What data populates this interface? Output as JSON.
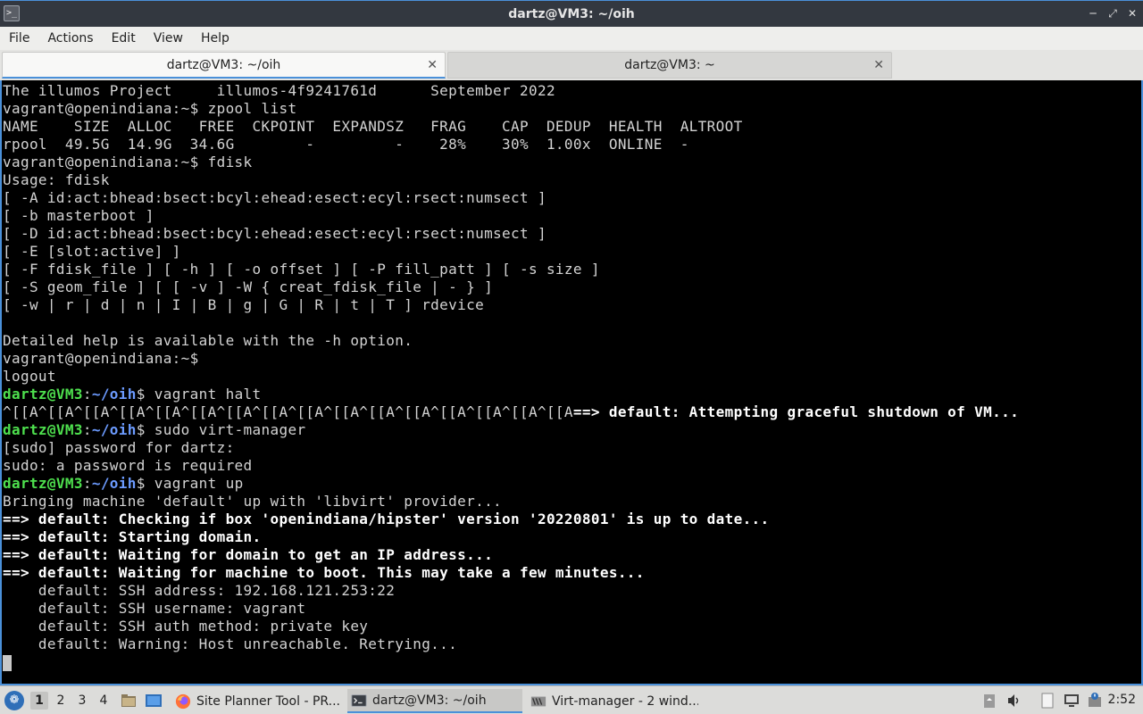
{
  "window": {
    "title": "dartz@VM3: ~/oih"
  },
  "menu": [
    "File",
    "Actions",
    "Edit",
    "View",
    "Help"
  ],
  "tabs": [
    {
      "label": "dartz@VM3: ~/oih",
      "active": true
    },
    {
      "label": "dartz@VM3: ~",
      "active": false
    }
  ],
  "terminal": {
    "lines": [
      [
        {
          "t": "The illumos Project     illumos-4f9241761d      September 2022"
        }
      ],
      [
        {
          "t": "vagrant@openindiana:~$ zpool list"
        }
      ],
      [
        {
          "t": "NAME    SIZE  ALLOC   FREE  CKPOINT  EXPANDSZ   FRAG    CAP  DEDUP  HEALTH  ALTROOT"
        }
      ],
      [
        {
          "t": "rpool  49.5G  14.9G  34.6G        -         -    28%    30%  1.00x  ONLINE  -"
        }
      ],
      [
        {
          "t": "vagrant@openindiana:~$ fdisk"
        }
      ],
      [
        {
          "t": "Usage: fdisk"
        }
      ],
      [
        {
          "t": "[ -A id:act:bhead:bsect:bcyl:ehead:esect:ecyl:rsect:numsect ]"
        }
      ],
      [
        {
          "t": "[ -b masterboot ]"
        }
      ],
      [
        {
          "t": "[ -D id:act:bhead:bsect:bcyl:ehead:esect:ecyl:rsect:numsect ]"
        }
      ],
      [
        {
          "t": "[ -E [slot:active] ]"
        }
      ],
      [
        {
          "t": "[ -F fdisk_file ] [ -h ] [ -o offset ] [ -P fill_patt ] [ -s size ]"
        }
      ],
      [
        {
          "t": "[ -S geom_file ] [ [ -v ] -W { creat_fdisk_file | - } ]"
        }
      ],
      [
        {
          "t": "[ -w | r | d | n | I | B | g | G | R | t | T ] rdevice"
        }
      ],
      [
        {
          "t": ""
        }
      ],
      [
        {
          "t": "Detailed help is available with the -h option."
        }
      ],
      [
        {
          "t": "vagrant@openindiana:~$"
        }
      ],
      [
        {
          "t": "logout"
        }
      ],
      [
        {
          "t": "dartz@VM3",
          "c": "pu"
        },
        {
          "t": ":"
        },
        {
          "t": "~/oih",
          "c": "pp"
        },
        {
          "t": "$ vagrant halt"
        }
      ],
      [
        {
          "t": "^[[A^[[A^[[A^[[A^[[A^[[A^[[A^[[A^[[A^[[A^[[A^[[A^[[A^[[A^[[A^[[A"
        },
        {
          "t": "==> default: Attempting graceful shutdown of VM...",
          "c": "bold"
        }
      ],
      [
        {
          "t": "dartz@VM3",
          "c": "pu"
        },
        {
          "t": ":"
        },
        {
          "t": "~/oih",
          "c": "pp"
        },
        {
          "t": "$ sudo virt-manager"
        }
      ],
      [
        {
          "t": "[sudo] password for dartz:"
        }
      ],
      [
        {
          "t": "sudo: a password is required"
        }
      ],
      [
        {
          "t": "dartz@VM3",
          "c": "pu"
        },
        {
          "t": ":"
        },
        {
          "t": "~/oih",
          "c": "pp"
        },
        {
          "t": "$ vagrant up"
        }
      ],
      [
        {
          "t": "Bringing machine 'default' up with 'libvirt' provider..."
        }
      ],
      [
        {
          "t": "==> default: Checking if box 'openindiana/hipster' version '20220801' is up to date...",
          "c": "bold"
        }
      ],
      [
        {
          "t": "==> default: Starting domain.",
          "c": "bold"
        }
      ],
      [
        {
          "t": "==> default: Waiting for domain to get an IP address...",
          "c": "bold"
        }
      ],
      [
        {
          "t": "==> default: Waiting for machine to boot. This may take a few minutes...",
          "c": "bold"
        }
      ],
      [
        {
          "t": "    default: SSH address: 192.168.121.253:22"
        }
      ],
      [
        {
          "t": "    default: SSH username: vagrant"
        }
      ],
      [
        {
          "t": "    default: SSH auth method: private key"
        }
      ],
      [
        {
          "t": "    default: Warning: Host unreachable. Retrying..."
        }
      ]
    ]
  },
  "taskbar": {
    "workspaces": [
      "1",
      "2",
      "3",
      "4"
    ],
    "tasks": [
      {
        "label": "Site Planner Tool - PR...",
        "icon": "firefox-icon"
      },
      {
        "label": "dartz@VM3: ~/oih",
        "icon": "terminal-icon",
        "active": true
      },
      {
        "label": "Virt-manager - 2 wind...",
        "icon": "virt-manager-icon"
      }
    ],
    "clock": "2:52"
  }
}
